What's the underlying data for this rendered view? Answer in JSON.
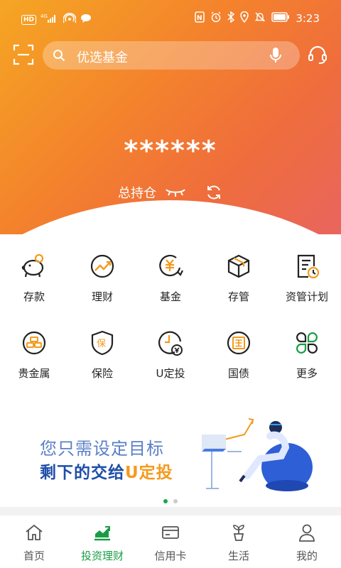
{
  "status_bar": {
    "left_badge": "HD",
    "network": "4G",
    "time": "3:23"
  },
  "search": {
    "placeholder": "优选基金"
  },
  "account": {
    "balance_masked": "******",
    "holdings_label": "总持仓"
  },
  "grid": {
    "row1": [
      {
        "label": "存款",
        "icon": "piggy-bank-icon"
      },
      {
        "label": "理财",
        "icon": "trend-chart-icon"
      },
      {
        "label": "基金",
        "icon": "fund-icon"
      },
      {
        "label": "存管",
        "icon": "box-icon"
      },
      {
        "label": "资管计划",
        "icon": "plan-doc-icon"
      }
    ],
    "row2": [
      {
        "label": "贵金属",
        "icon": "gold-bars-icon"
      },
      {
        "label": "保险",
        "icon": "shield-icon"
      },
      {
        "label": "U定投",
        "icon": "clock-coin-icon"
      },
      {
        "label": "国债",
        "icon": "national-bond-icon"
      },
      {
        "label": "更多",
        "icon": "four-leaf-icon"
      }
    ]
  },
  "banner": {
    "line1": "您只需设定目标",
    "line2_prefix": "剩下的交给",
    "line2_highlight": "U定投"
  },
  "pager": {
    "count": 2,
    "active_index": 0
  },
  "bottom_nav": [
    {
      "label": "首页",
      "icon": "home-icon",
      "active": false
    },
    {
      "label": "投资理财",
      "icon": "investment-chart-icon",
      "active": true
    },
    {
      "label": "信用卡",
      "icon": "credit-card-icon",
      "active": false
    },
    {
      "label": "生活",
      "icon": "plant-pot-icon",
      "active": false
    },
    {
      "label": "我的",
      "icon": "user-icon",
      "active": false
    }
  ],
  "colors": {
    "accent_green": "#1a9c46",
    "icon_orange": "#f29b1d",
    "hero_start": "#f5a623",
    "hero_end": "#e9655e"
  }
}
